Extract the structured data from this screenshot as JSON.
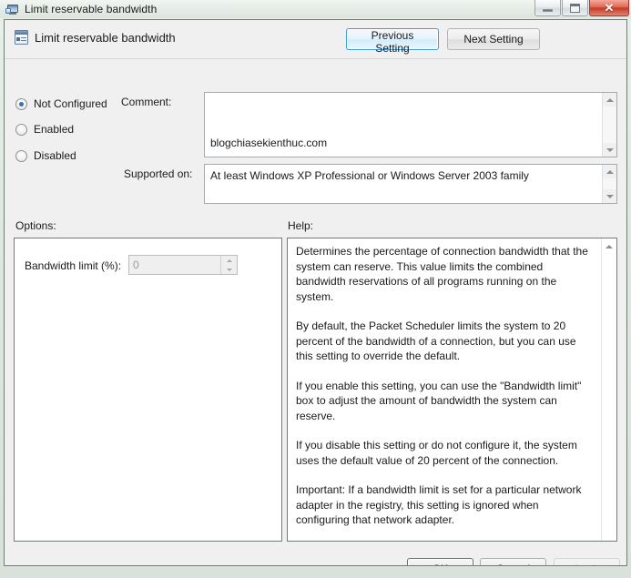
{
  "window": {
    "title": "Limit reservable bandwidth",
    "icon": "policy-setting-icon",
    "buttons": {
      "minimize": "–",
      "maximize": "□",
      "close": "✕"
    }
  },
  "header": {
    "icon": "policy-document-icon",
    "title": "Limit reservable bandwidth",
    "previous_setting": "Previous Setting",
    "next_setting": "Next Setting"
  },
  "state": {
    "options": [
      {
        "id": "not-configured",
        "label": "Not Configured",
        "selected": true
      },
      {
        "id": "enabled",
        "label": "Enabled",
        "selected": false
      },
      {
        "id": "disabled",
        "label": "Disabled",
        "selected": false
      }
    ]
  },
  "comment": {
    "label": "Comment:",
    "value": "blogchiasekienthuc.com"
  },
  "supported": {
    "label": "Supported on:",
    "value": "At least Windows XP Professional or Windows Server 2003 family"
  },
  "options_panel": {
    "label": "Options:",
    "bandwidth_label": "Bandwidth limit (%):",
    "bandwidth_value": "0"
  },
  "help_panel": {
    "label": "Help:",
    "paragraphs": [
      "Determines the percentage of connection bandwidth that the system can reserve. This value limits the combined bandwidth reservations of all programs running on the system.",
      "By default, the Packet Scheduler limits the system to 20 percent of the bandwidth of a connection, but you can use this setting to override the default.",
      "If you enable this setting, you can use the \"Bandwidth limit\" box to adjust the amount of bandwidth the system can reserve.",
      "If you disable this setting or do not configure it, the system uses the default value of 20 percent of the connection.",
      "Important: If a bandwidth limit is set for a particular network adapter in the registry, this setting is ignored when configuring that network adapter."
    ]
  },
  "footer": {
    "ok": "OK",
    "cancel": "Cancel",
    "apply": "Apply"
  },
  "colors": {
    "accent_focus": "#3c9ddf",
    "close_button": "#c23b24",
    "radio_dot": "#3a6fa8",
    "dialog_background": "#f0f0f0"
  }
}
